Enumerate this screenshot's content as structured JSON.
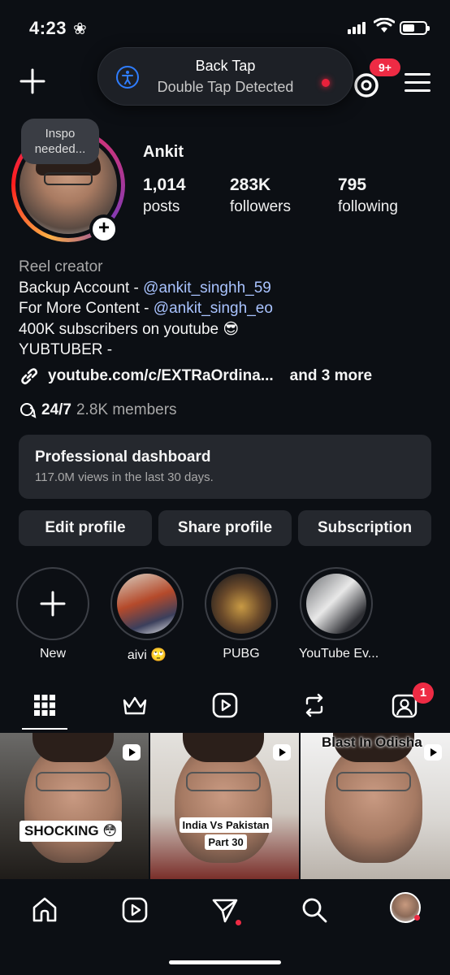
{
  "status_bar": {
    "time": "4:23"
  },
  "top_nav": {
    "threads_badge": "9+"
  },
  "back_tap": {
    "title": "Back Tap",
    "subtitle": "Double Tap Detected"
  },
  "profile": {
    "note": "Inspo needed...",
    "username": "Ankit",
    "stats": [
      {
        "value": "1,014",
        "label": "posts"
      },
      {
        "value": "283K",
        "label": "followers"
      },
      {
        "value": "795",
        "label": "following"
      }
    ],
    "bio": {
      "category": "Reel creator",
      "line1_text": "Backup Account - ",
      "line1_link": "@ankit_singhh_59",
      "line2_text": "For More Content - ",
      "line2_link": "@ankit_singh_eo",
      "line3": "400K subscribers on youtube 😎",
      "line4": "YUBTUBER -"
    },
    "external_link": "youtube.com/c/EXTRaOrdina...",
    "external_more": "and 3 more",
    "channel": {
      "name": "24/7",
      "members": "2.8K members"
    }
  },
  "dashboard": {
    "title": "Professional dashboard",
    "subtitle": "117.0M views in the last 30 days."
  },
  "buttons": {
    "edit": "Edit profile",
    "share": "Share profile",
    "subscription": "Subscription"
  },
  "highlights": [
    {
      "label": "New"
    },
    {
      "label": "aivi 🙄"
    },
    {
      "label": "PUBG"
    },
    {
      "label": "YouTube Ev..."
    }
  ],
  "tabs": {
    "tagged_badge": "1"
  },
  "grid": [
    {
      "caption": "SHOCKING 😳"
    },
    {
      "caption_line1": "India Vs Pakistan",
      "caption_line2": "Part 30"
    },
    {
      "caption": "Blast In Odisha"
    }
  ],
  "colors": {
    "background": "#0c0f14",
    "surface": "#25282e",
    "badge": "#ee2b44",
    "link": "#a9c3ff"
  }
}
